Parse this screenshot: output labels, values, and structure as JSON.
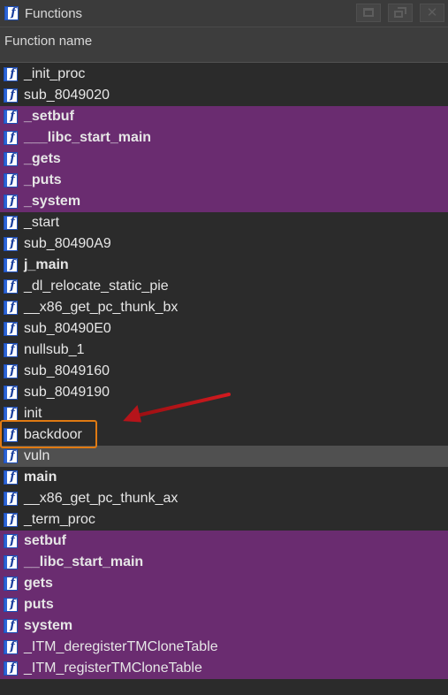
{
  "window": {
    "title": "Functions",
    "title_icon": "function-icon",
    "buttons": [
      "maximize-icon",
      "restore-icon",
      "close-icon"
    ]
  },
  "header": {
    "column_label": "Function name"
  },
  "colors": {
    "library_row": "#6a2c70",
    "selected_row": "#505050",
    "background": "#2b2b2b",
    "highlight_box": "#e07a12",
    "arrow": "#c0161b"
  },
  "functions": [
    {
      "name": "_init_proc",
      "lib": false,
      "bold": false
    },
    {
      "name": "sub_8049020",
      "lib": false,
      "bold": false
    },
    {
      "name": "_setbuf",
      "lib": true,
      "bold": true
    },
    {
      "name": "___libc_start_main",
      "lib": true,
      "bold": true
    },
    {
      "name": "_gets",
      "lib": true,
      "bold": true
    },
    {
      "name": "_puts",
      "lib": true,
      "bold": true
    },
    {
      "name": "_system",
      "lib": true,
      "bold": true
    },
    {
      "name": "_start",
      "lib": false,
      "bold": false
    },
    {
      "name": "sub_80490A9",
      "lib": false,
      "bold": false
    },
    {
      "name": "j_main",
      "lib": false,
      "bold": true
    },
    {
      "name": "_dl_relocate_static_pie",
      "lib": false,
      "bold": false
    },
    {
      "name": "__x86_get_pc_thunk_bx",
      "lib": false,
      "bold": false
    },
    {
      "name": "sub_80490E0",
      "lib": false,
      "bold": false
    },
    {
      "name": "nullsub_1",
      "lib": false,
      "bold": false
    },
    {
      "name": "sub_8049160",
      "lib": false,
      "bold": false
    },
    {
      "name": "sub_8049190",
      "lib": false,
      "bold": false
    },
    {
      "name": "init",
      "lib": false,
      "bold": false
    },
    {
      "name": "backdoor",
      "lib": false,
      "bold": false,
      "highlighted": true
    },
    {
      "name": "vuln",
      "lib": false,
      "bold": false,
      "selected": true
    },
    {
      "name": "main",
      "lib": false,
      "bold": true
    },
    {
      "name": "__x86_get_pc_thunk_ax",
      "lib": false,
      "bold": false
    },
    {
      "name": "_term_proc",
      "lib": false,
      "bold": false
    },
    {
      "name": "setbuf",
      "lib": true,
      "bold": true
    },
    {
      "name": "__libc_start_main",
      "lib": true,
      "bold": true
    },
    {
      "name": "gets",
      "lib": true,
      "bold": true
    },
    {
      "name": "puts",
      "lib": true,
      "bold": true
    },
    {
      "name": "system",
      "lib": true,
      "bold": true
    },
    {
      "name": "_ITM_deregisterTMCloneTable",
      "lib": true,
      "bold": false
    },
    {
      "name": "_ITM_registerTMCloneTable",
      "lib": true,
      "bold": false
    }
  ]
}
